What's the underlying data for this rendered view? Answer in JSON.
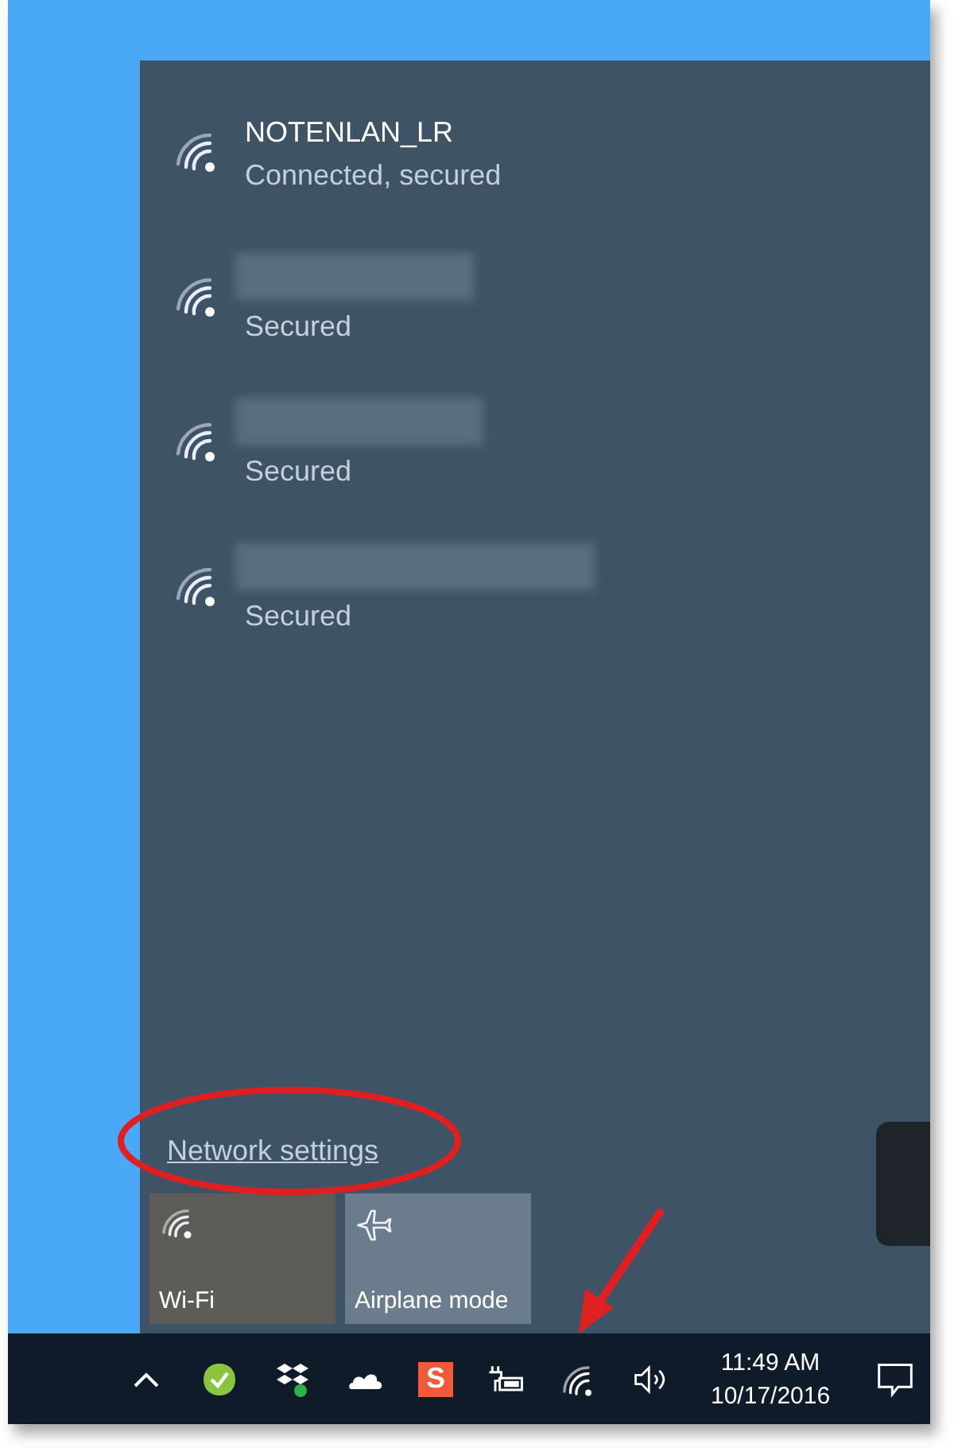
{
  "networks": [
    {
      "name": "NOTENLAN_LR",
      "status": "Connected, secured",
      "redacted": false
    },
    {
      "status": "Secured",
      "redacted": true
    },
    {
      "status": "Secured",
      "redacted": true
    },
    {
      "status": "Secured",
      "redacted": true
    }
  ],
  "settings_link": "Network settings",
  "tiles": [
    {
      "kind": "wifi",
      "label": "Wi-Fi",
      "on": true
    },
    {
      "kind": "airplane",
      "label": "Airplane mode",
      "on": false
    }
  ],
  "taskbar": {
    "app_badge": "S",
    "time": "11:49 AM",
    "date": "10/17/2016"
  }
}
